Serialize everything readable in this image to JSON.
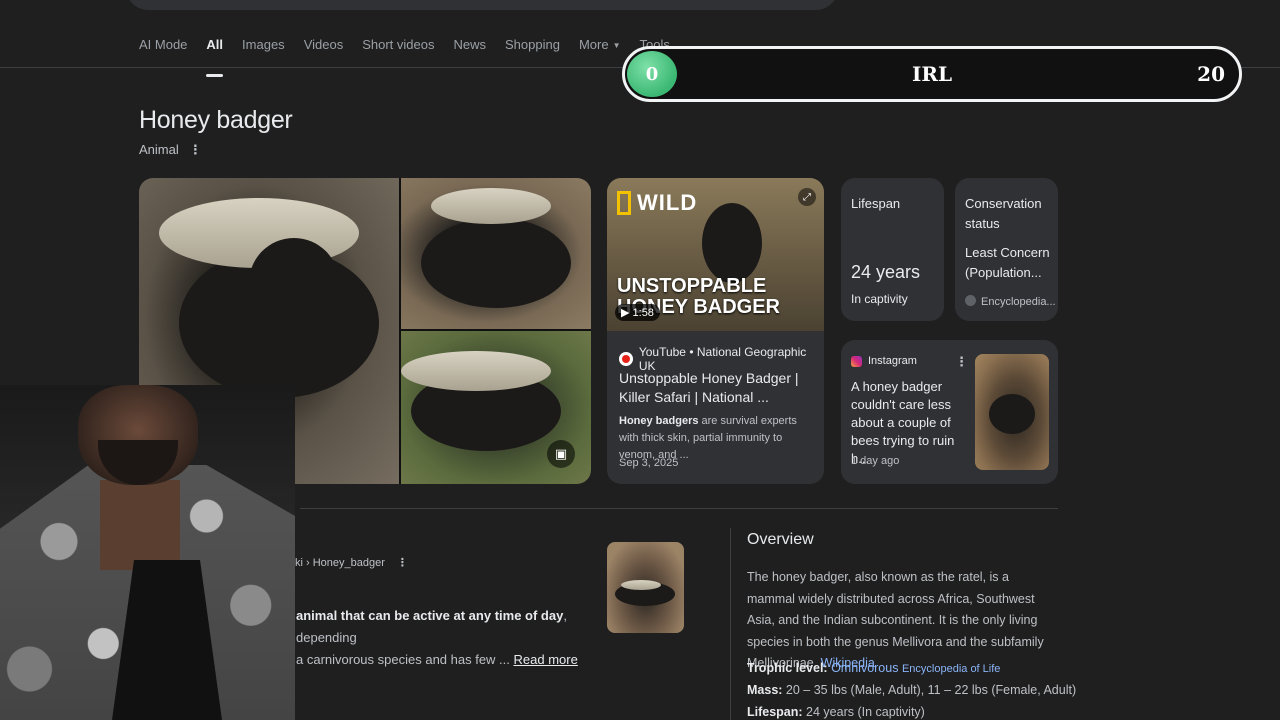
{
  "tabs": [
    {
      "label": "AI Mode"
    },
    {
      "label": "All"
    },
    {
      "label": "Images"
    },
    {
      "label": "Videos"
    },
    {
      "label": "Short videos"
    },
    {
      "label": "News"
    },
    {
      "label": "Shopping"
    },
    {
      "label": "More"
    },
    {
      "label": "Tools"
    }
  ],
  "active_tab": "All",
  "overlay": {
    "min": "0",
    "label": "IRL",
    "max": "20",
    "progress": 0
  },
  "knowledge_panel": {
    "title": "Honey badger",
    "subtitle": "Animal"
  },
  "video": {
    "brand": "WILD",
    "thumb_title": "UNSTOPPABLE HONEY BADGER",
    "duration": "1:58",
    "source": "YouTube • National Geographic UK",
    "title": "Unstoppable Honey Badger | Killer Safari | National ...",
    "snippet_bold": "Honey badgers",
    "snippet_rest": " are survival experts with thick skin, partial immunity to venom, and ...",
    "date": "Sep 3, 2025"
  },
  "facts": {
    "lifespan": {
      "label": "Lifespan",
      "value": "24 years",
      "note": "In captivity"
    },
    "conservation": {
      "label": "Conservation status",
      "value": "Least Concern (Population...",
      "source": "Encyclopedia..."
    }
  },
  "instagram": {
    "source": "Instagram",
    "text": "A honey badger couldn't care less about a couple of bees trying to ruin h...",
    "date": "1 day ago"
  },
  "wiki_result": {
    "crumb": "ki › Honey_badger",
    "snippet_bold": "animal that can be active at any time of day",
    "snippet_rest": ", depending",
    "snippet_line2": " a carnivorous species and has few ... ",
    "read_more": "Read more"
  },
  "overview": {
    "title": "Overview",
    "text": "The honey badger, also known as the ratel, is a mammal widely distributed across Africa, Southwest Asia, and the Indian subcontinent. It is the only living species in both the genus Mellivora and the subfamily Mellivorinae. ",
    "link": "Wikipedia",
    "trophic_label": "Trophic level:",
    "trophic_value": "Omnivorous",
    "trophic_source": "Encyclopedia of Life",
    "mass_label": "Mass:",
    "mass_value": " 20 – 35 lbs (Male, Adult), 11 – 22 lbs (Female, Adult)",
    "lifespan_label": "Lifespan:",
    "lifespan_value": " 24 years (In captivity)"
  },
  "colors": {
    "background": "#1f1f1f",
    "card": "#303134",
    "link": "#8ab4f8",
    "accent_green": "#3bb873"
  }
}
